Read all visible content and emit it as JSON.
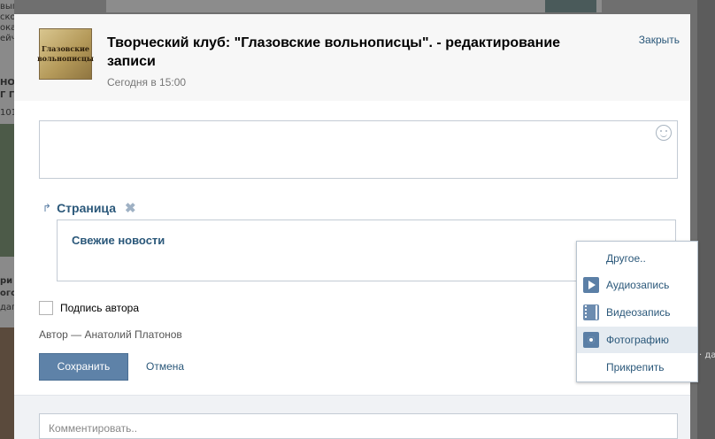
{
  "background": {
    "left_text": [
      "выгоду при",
      "ское",
      "ока",
      "ейч",
      "НО",
      "Г ГО",
      "101",
      "ри",
      "ого",
      "дап"
    ],
    "right_text": [
      "· да"
    ]
  },
  "modal": {
    "logo_lines": [
      "Глазовские",
      "вольнописцы"
    ],
    "title": "Творческий клуб: \"Глазовские вольнописцы\". - редактирование записи",
    "date": "Сегодня в 15:00",
    "close_label": "Закрыть",
    "editor_value": "",
    "attachment": {
      "type_label": "Страница",
      "page_name": "Свежие новости"
    },
    "signature_label": "Подпись автора",
    "signature_checked": false,
    "author_line": "Автор — Анатолий Платонов",
    "save_label": "Сохранить",
    "cancel_label": "Отмена",
    "comment_placeholder": "Комментировать.."
  },
  "attach_menu": {
    "items": [
      {
        "label": "Другое..",
        "icon": "none"
      },
      {
        "label": "Аудиозапись",
        "icon": "play-icon"
      },
      {
        "label": "Видеозапись",
        "icon": "film-icon"
      },
      {
        "label": "Фотографию",
        "icon": "camera-icon",
        "highlighted": true
      },
      {
        "label": "Прикрепить",
        "icon": "none"
      }
    ]
  },
  "colors": {
    "link": "#2b587a",
    "button": "#5e82a8",
    "icon": "#5b7fa6",
    "highlight": "#e5ebf1"
  }
}
